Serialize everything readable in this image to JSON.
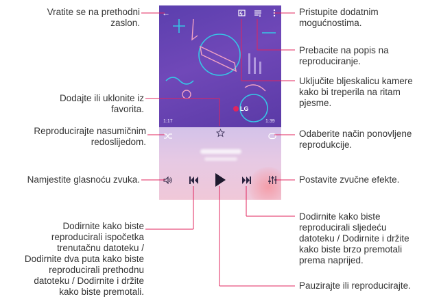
{
  "screen": {
    "time_elapsed": "1:17",
    "time_total": "1:39",
    "logo_text": "LG"
  },
  "icons": {
    "back": "arrow-left-icon",
    "flash": "camera-flash-icon",
    "playlist": "playlist-icon",
    "more": "more-options-icon",
    "favorite": "star-outline-icon",
    "shuffle": "shuffle-icon",
    "repeat": "repeat-icon",
    "volume": "volume-icon",
    "previous": "skip-previous-icon",
    "play": "play-icon",
    "next": "skip-next-icon",
    "equalizer": "sound-effects-icon"
  },
  "callouts": {
    "back": "Vratite se na prethodni\nzaslon.",
    "favorite": "Dodajte ili uklonite iz\nfavorita.",
    "shuffle": "Reproducirajte nasumičnim\nredoslijedom.",
    "volume": "Namjestite glasnoću zvuka.",
    "previous": "Dodirnite kako biste\nreproducirali ispočetka\ntrenutačnu datoteku /\nDodirnite dva puta kako biste\nreproducirali prethodnu\ndatoteku / Dodirnite i držite\nkako biste premotali.",
    "more": "Pristupite dodatnim\nmogućnostima.",
    "playlist": "Prebacite na popis na\nreproduciranje.",
    "flash": "Uključite bljeskalicu kamere\nkako bi treperila na ritam\npjesme.",
    "repeat": "Odaberite način ponovljene\nreprodukcije.",
    "equalizer": "Postavite zvučne efekte.",
    "next": "Dodirnite kako biste\nreproducirali sljedeću\ndatoteku / Dodirnite i držite\nkako biste brzo premotali\nprema naprijed.",
    "play": "Pauzirajte ili reproducirajte."
  },
  "colors": {
    "leader_line": "#e0245e",
    "art_purple": "#6a4fb0"
  }
}
